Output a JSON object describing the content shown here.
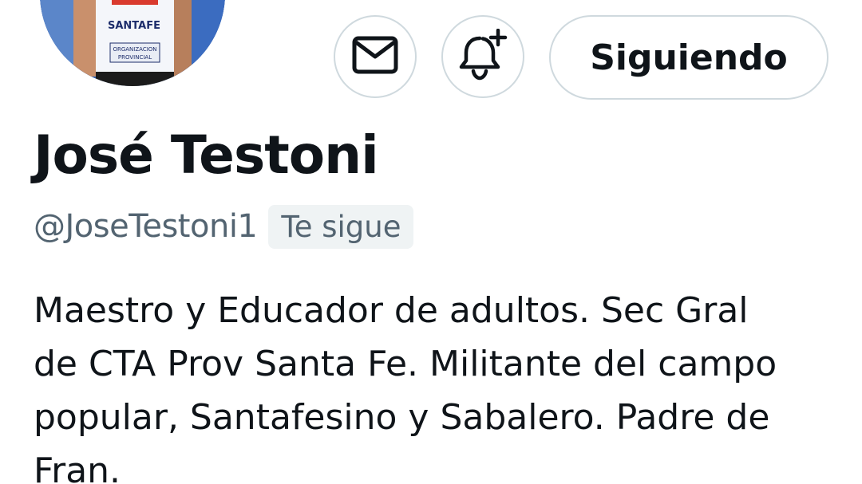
{
  "profile": {
    "avatar_label": "profile-avatar",
    "avatar_text": [
      "SANTAFE",
      "ORGANIZACION",
      "PROVINCIAL"
    ],
    "display_name": "José Testoni",
    "handle": "@JoseTestoni1",
    "follows_you_badge": "Te sigue",
    "bio_lines": [
      "Maestro y Educador de adultos. Sec Gral",
      "de CTA Prov Santa Fe. Militante del campo",
      "popular, Santafesino y Sabalero. Padre de",
      "Fran."
    ]
  },
  "actions": {
    "message_icon": "envelope-icon",
    "notify_icon": "bell-plus-icon",
    "follow_label": "Siguiendo"
  },
  "colors": {
    "text_primary": "#0f1419",
    "text_secondary": "#536471",
    "border": "#cfd9de",
    "badge_bg": "#eff3f4",
    "background": "#ffffff"
  }
}
